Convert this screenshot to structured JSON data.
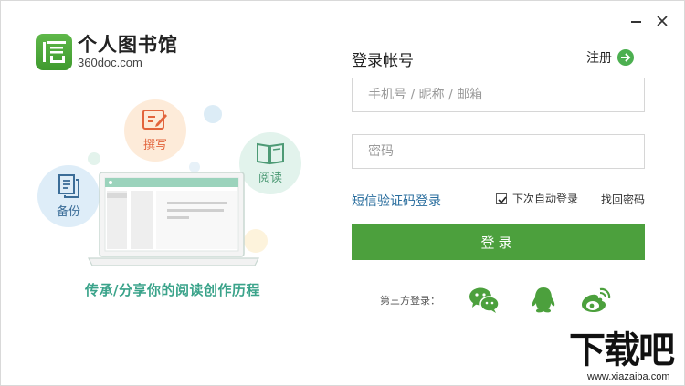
{
  "window": {
    "minimize_icon": "minimize-icon",
    "close_icon": "close-icon"
  },
  "logo": {
    "title": "个人图书馆",
    "url": "360doc.com",
    "brand_color": "#4ca03d"
  },
  "features": {
    "write": {
      "label": "撰写",
      "icon": "edit-icon",
      "color": "#e2643c"
    },
    "read": {
      "label": "阅读",
      "icon": "book-icon",
      "color": "#4d9a75"
    },
    "backup": {
      "label": "备份",
      "icon": "document-copy-icon",
      "color": "#3b6d98"
    }
  },
  "slogan": "传承/分享你的阅读创作历程",
  "login": {
    "title": "登录帐号",
    "register_label": "注册",
    "account_placeholder": "手机号 / 昵称 / 邮箱",
    "password_placeholder": "密码",
    "sms_login": "短信验证码登录",
    "auto_login_label": "下次自动登录",
    "auto_login_checked": true,
    "forgot_password": "找回密码",
    "submit_label": "登录",
    "third_party_label": "第三方登录：",
    "third_party": [
      "wechat-icon",
      "qq-icon",
      "weibo-icon"
    ],
    "accent_color": "#4ca03d"
  },
  "watermark": {
    "text": "下载吧",
    "url": "www.xiazaiba.com"
  }
}
